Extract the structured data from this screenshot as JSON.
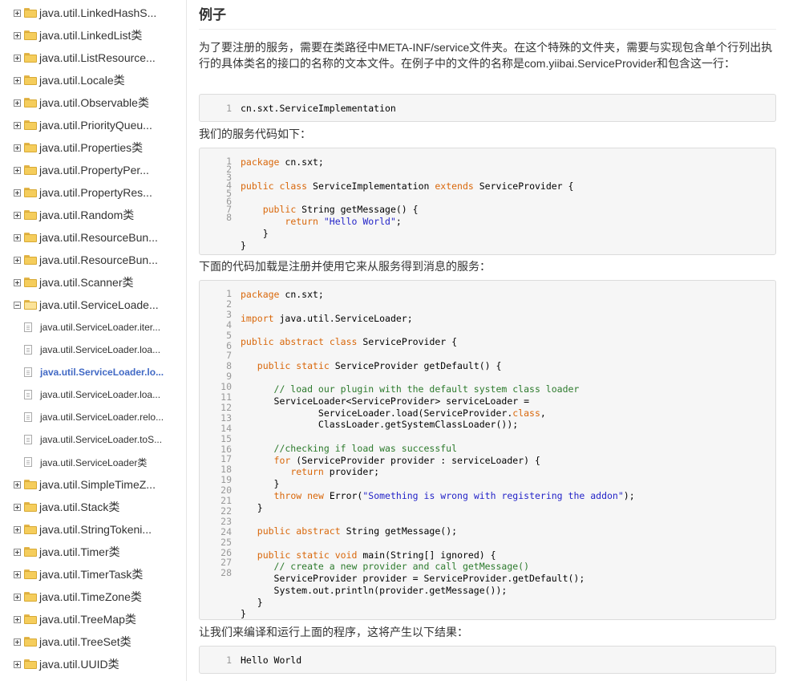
{
  "sidebar": {
    "items": [
      {
        "label": "java.util.LinkedHashS...",
        "type": "folder",
        "expanded": false
      },
      {
        "label": "java.util.LinkedList类",
        "type": "folder",
        "expanded": false
      },
      {
        "label": "java.util.ListResource...",
        "type": "folder",
        "expanded": false
      },
      {
        "label": "java.util.Locale类",
        "type": "folder",
        "expanded": false
      },
      {
        "label": "java.util.Observable类",
        "type": "folder",
        "expanded": false
      },
      {
        "label": "java.util.PriorityQueu...",
        "type": "folder",
        "expanded": false
      },
      {
        "label": "java.util.Properties类",
        "type": "folder",
        "expanded": false
      },
      {
        "label": "java.util.PropertyPer...",
        "type": "folder",
        "expanded": false
      },
      {
        "label": "java.util.PropertyRes...",
        "type": "folder",
        "expanded": false
      },
      {
        "label": "java.util.Random类",
        "type": "folder",
        "expanded": false
      },
      {
        "label": "java.util.ResourceBun...",
        "type": "folder",
        "expanded": false
      },
      {
        "label": "java.util.ResourceBun...",
        "type": "folder",
        "expanded": false
      },
      {
        "label": "java.util.Scanner类",
        "type": "folder",
        "expanded": false
      },
      {
        "label": "java.util.ServiceLoade...",
        "type": "folder",
        "expanded": true
      },
      {
        "label": "java.util.ServiceLoader.iter...",
        "type": "page"
      },
      {
        "label": "java.util.ServiceLoader.loa...",
        "type": "page"
      },
      {
        "label": "java.util.ServiceLoader.lo...",
        "type": "page",
        "active": true
      },
      {
        "label": "java.util.ServiceLoader.loa...",
        "type": "page"
      },
      {
        "label": "java.util.ServiceLoader.relo...",
        "type": "page"
      },
      {
        "label": "java.util.ServiceLoader.toS...",
        "type": "page"
      },
      {
        "label": "java.util.ServiceLoader类",
        "type": "page"
      },
      {
        "label": "java.util.SimpleTimeZ...",
        "type": "folder",
        "expanded": false
      },
      {
        "label": "java.util.Stack类",
        "type": "folder",
        "expanded": false
      },
      {
        "label": "java.util.StringTokeni...",
        "type": "folder",
        "expanded": false
      },
      {
        "label": "java.util.Timer类",
        "type": "folder",
        "expanded": false
      },
      {
        "label": "java.util.TimerTask类",
        "type": "folder",
        "expanded": false
      },
      {
        "label": "java.util.TimeZone类",
        "type": "folder",
        "expanded": false
      },
      {
        "label": "java.util.TreeMap类",
        "type": "folder",
        "expanded": false
      },
      {
        "label": "java.util.TreeSet类",
        "type": "folder",
        "expanded": false
      },
      {
        "label": "java.util.UUID类",
        "type": "folder",
        "expanded": false
      }
    ]
  },
  "content": {
    "heading": "例子",
    "intro": "为了要注册的服务，需要在类路径中META-INF/service文件夹。在这个特殊的文件夹，需要与实现包含单个行列出执行的具体类名的接口的名称的文本文件。在例子中的文件的名称是com.yiibai.ServiceProvider和包含这一行：",
    "service_code_label": "我们的服务代码如下：",
    "loader_code_label": "下面的代码加载是注册并使用它来从服务得到消息的服务：",
    "result_label": "让我们来编译和运行上面的程序，这将产生以下结果：",
    "code_blocks": [
      {
        "lines": [
          "1"
        ],
        "code": [
          [
            [
              "p",
              "cn.sxt.ServiceImplementation"
            ]
          ]
        ]
      },
      {
        "lines": [
          "1",
          "2",
          "3",
          "4",
          "5",
          "6",
          "7",
          "8"
        ],
        "code": [
          [
            [
              "k",
              "package"
            ],
            [
              "p",
              " cn.sxt;"
            ]
          ],
          [],
          [
            [
              "k",
              "public"
            ],
            [
              "p",
              " "
            ],
            [
              "k",
              "class"
            ],
            [
              "p",
              " ServiceImplementation "
            ],
            [
              "k",
              "extends"
            ],
            [
              "p",
              " ServiceProvider {"
            ]
          ],
          [],
          [
            [
              "p",
              "    "
            ],
            [
              "k",
              "public"
            ],
            [
              "p",
              " String getMessage() {"
            ]
          ],
          [
            [
              "p",
              "        "
            ],
            [
              "k",
              "return"
            ],
            [
              "p",
              " "
            ],
            [
              "s",
              "\"Hello World\""
            ],
            [
              "p",
              ";"
            ]
          ],
          [
            [
              "p",
              "    }"
            ]
          ],
          [
            [
              "p",
              "}"
            ]
          ]
        ]
      },
      {
        "lines": [
          "1",
          "2",
          "3",
          "4",
          "5",
          "6",
          "7",
          "8",
          "9",
          "10",
          "11",
          "12",
          "13",
          "14",
          "15",
          "16",
          "17",
          "18",
          "19",
          "20",
          "21",
          "22",
          "23",
          "24",
          "25",
          "26",
          "27",
          "28"
        ],
        "code": [
          [
            [
              "k",
              "package"
            ],
            [
              "p",
              " cn.sxt;"
            ]
          ],
          [],
          [
            [
              "k",
              "import"
            ],
            [
              "p",
              " java.util.ServiceLoader;"
            ]
          ],
          [],
          [
            [
              "k",
              "public"
            ],
            [
              "p",
              " "
            ],
            [
              "k",
              "abstract"
            ],
            [
              "p",
              " "
            ],
            [
              "k",
              "class"
            ],
            [
              "p",
              " ServiceProvider {"
            ]
          ],
          [],
          [
            [
              "p",
              "   "
            ],
            [
              "k",
              "public"
            ],
            [
              "p",
              " "
            ],
            [
              "k",
              "static"
            ],
            [
              "p",
              " ServiceProvider getDefault() {"
            ]
          ],
          [],
          [
            [
              "c",
              "      // load our plugin with the default system class loader"
            ]
          ],
          [
            [
              "p",
              "      ServiceLoader<ServiceProvider> serviceLoader ="
            ]
          ],
          [
            [
              "p",
              "              ServiceLoader.load(ServiceProvider."
            ],
            [
              "k",
              "class"
            ],
            [
              "p",
              ","
            ]
          ],
          [
            [
              "p",
              "              ClassLoader.getSystemClassLoader());"
            ]
          ],
          [],
          [
            [
              "c",
              "      //checking if load was successful"
            ]
          ],
          [
            [
              "p",
              "      "
            ],
            [
              "k",
              "for"
            ],
            [
              "p",
              " (ServiceProvider provider : serviceLoader) {"
            ]
          ],
          [
            [
              "p",
              "         "
            ],
            [
              "k",
              "return"
            ],
            [
              "p",
              " provider;"
            ]
          ],
          [
            [
              "p",
              "      }"
            ]
          ],
          [
            [
              "p",
              "      "
            ],
            [
              "k",
              "throw"
            ],
            [
              "p",
              " "
            ],
            [
              "k",
              "new"
            ],
            [
              "p",
              " Error("
            ],
            [
              "s",
              "\"Something is wrong with registering the addon\""
            ],
            [
              "p",
              ");"
            ]
          ],
          [
            [
              "p",
              "   }"
            ]
          ],
          [],
          [
            [
              "p",
              "   "
            ],
            [
              "k",
              "public"
            ],
            [
              "p",
              " "
            ],
            [
              "k",
              "abstract"
            ],
            [
              "p",
              " String getMessage();"
            ]
          ],
          [],
          [
            [
              "p",
              "   "
            ],
            [
              "k",
              "public"
            ],
            [
              "p",
              " "
            ],
            [
              "k",
              "static"
            ],
            [
              "p",
              " "
            ],
            [
              "k",
              "void"
            ],
            [
              "p",
              " main(String[] ignored) {"
            ]
          ],
          [
            [
              "c",
              "      // create a new provider and call getMessage()"
            ]
          ],
          [
            [
              "p",
              "      ServiceProvider provider = ServiceProvider.getDefault();"
            ]
          ],
          [
            [
              "p",
              "      System.out.println(provider.getMessage());"
            ]
          ],
          [
            [
              "p",
              "   }"
            ]
          ],
          [
            [
              "p",
              "}"
            ]
          ]
        ]
      },
      {
        "lines": [
          "1"
        ],
        "code": [
          [
            [
              "p",
              "Hello World"
            ]
          ]
        ]
      }
    ]
  },
  "colors": {
    "keyword": "#d9670a",
    "string": "#2424c8",
    "comment": "#2c7a2c",
    "active_link": "#4169c5"
  }
}
